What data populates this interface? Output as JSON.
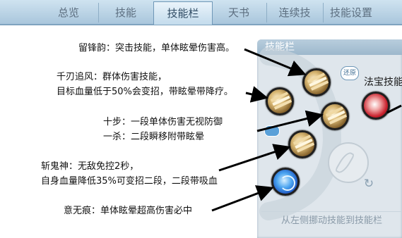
{
  "tabs": [
    {
      "label": "总览"
    },
    {
      "label": "技能"
    },
    {
      "label": "技能栏"
    },
    {
      "label": "天书"
    },
    {
      "label": "连续技"
    },
    {
      "label": "技能设置"
    }
  ],
  "active_tab": "技能栏",
  "panel": {
    "title": "技能栏",
    "restore_label": "还原",
    "fabao_label": "法宝技能",
    "hint": "从左侧挪动技能到技能栏"
  },
  "annotations": {
    "liufengyun": "留锋韵：突击技能，单体眩晕伤害高。",
    "qianren_line1": "千刃追风：群体伤害技能，",
    "qianren_line2": "目标血量低于50%会变招，带眩晕带降疗。",
    "shibu_line1": "十步：一段单体伤害无视防御",
    "shibu_line2": "一杀：二段瞬移附带眩晕",
    "zhanguishen_line1": "斩鬼神：无敌免控2秒，",
    "zhanguishen_line2": "自身血量降低35%可变招二段，二段带吸血",
    "yiwuhen": "意无痕：单体眩晕超高伤害必中"
  },
  "colors": {
    "tab_bar": "#a9c6dc",
    "panel_bg": "#dfe6ec",
    "panel_title": "#9db8cc",
    "arrow": "#000000"
  }
}
